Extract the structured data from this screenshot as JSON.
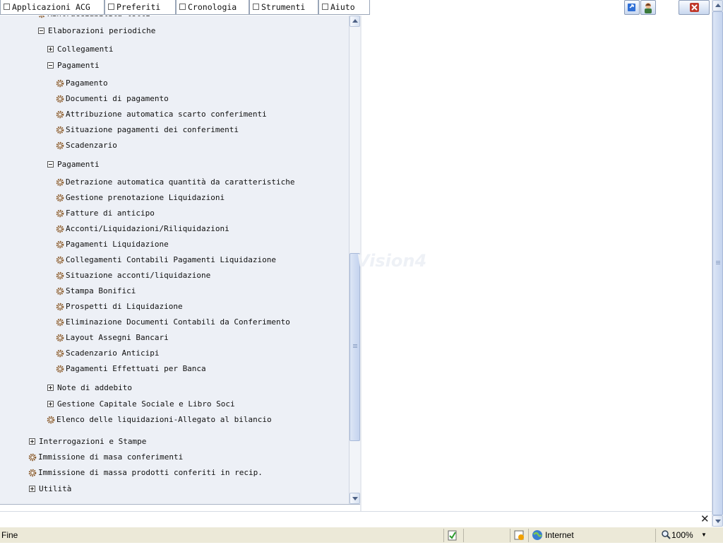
{
  "menubar": {
    "menus": [
      "Applicazioni ACG",
      "Preferiti",
      "Cronologia",
      "Strumenti",
      "Aiuto"
    ]
  },
  "tree": {
    "partial_top": "Rintracciabilità lotti",
    "elaborazioni": "Elaborazioni periodiche",
    "collegamenti": "Collegamenti",
    "pagamenti1": {
      "label": "Pagamenti",
      "items": [
        "Pagamento",
        "Documenti di pagamento",
        "Attribuzione automatica scarto conferimenti",
        "Situazione pagamenti dei conferimenti",
        "Scadenzario"
      ]
    },
    "pagamenti2": {
      "label": "Pagamenti",
      "items": [
        "Detrazione automatica quantità da caratteristiche",
        "Gestione prenotazione Liquidazioni",
        "Fatture di anticipo",
        "Acconti/Liquidazioni/Riliquidazioni",
        "Pagamenti Liquidazione",
        "Collegamenti Contabili Pagamenti Liquidazione",
        "Situazione acconti/liquidazione",
        "Stampa Bonifici",
        "Prospetti di Liquidazione",
        "Eliminazione Documenti Contabili da Conferimento",
        "Layout Assegni Bancari",
        "Scadenzario Anticipi",
        "Pagamenti Effettuati per Banca"
      ]
    },
    "note_addebito": "Note di addebito",
    "capitale_sociale": "Gestione Capitale Sociale e Libro Soci",
    "elenco_liquidazioni": "Elenco delle liquidazioni-Allegato al bilancio",
    "interrogazioni": "Interrogazioni e Stampe",
    "immissione_conferimenti": "Immissione di masa conferimenti",
    "immissione_recip": "Immissione di massa prodotti conferiti in recip.",
    "utilita": "Utilità"
  },
  "watermark": "Vision4",
  "status": {
    "left": "Fine",
    "zone": "Internet",
    "zoom": "100%"
  },
  "icons": [
    "restore-icon",
    "user-icon",
    "close-icon",
    "gear-icon",
    "expand-icon",
    "collapse-icon",
    "globe-icon",
    "lock-icon",
    "magnifier-icon"
  ],
  "colors": {
    "tree_bg": "#edf0f6",
    "close_red": "#c0392b",
    "status_bg": "#ece9d8"
  }
}
